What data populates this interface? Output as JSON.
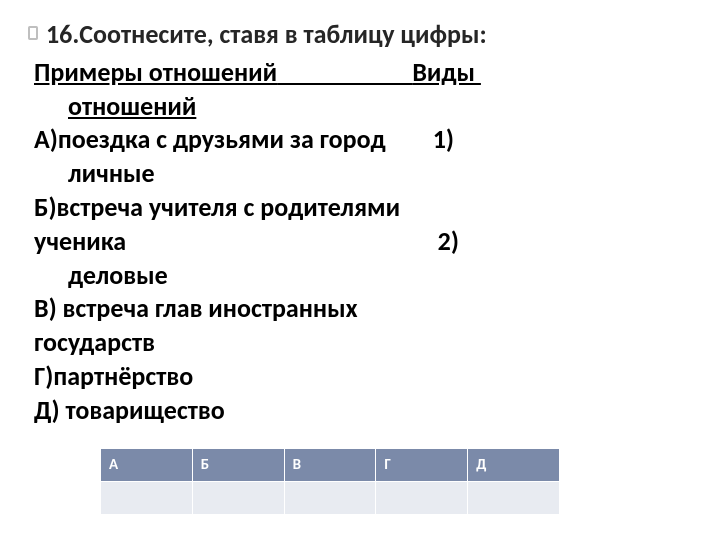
{
  "title": "16.Соотнесите, ставя в таблицу цифры:",
  "col_headers_line": {
    "left": "Примеры отношений",
    "spacer": "                       ",
    "right": "Виды "
  },
  "col_headers_cont": "отношений",
  "items": {
    "a_left": "А)поездка с друзьями за город",
    "a_spacer": "        ",
    "a_right": "1) ",
    "a_cont": "личные",
    "b_left": "Б)встреча учителя с родителями",
    "b_cont_left": "ученика",
    "b_cont_spacer": "                                                     ",
    "b_cont_right": "2) ",
    "b_cont2": "деловые",
    "v_left": "В) встреча глав иностранных",
    "v_cont": "государств",
    "g_left": "Г)партнёрство",
    "d_left": "Д) товарищество"
  },
  "table": {
    "headers": [
      "А",
      "Б",
      "В",
      "Г",
      "Д"
    ],
    "row": [
      "",
      "",
      "",
      "",
      ""
    ]
  },
  "chart_data": {
    "type": "table",
    "title": "Соотнесите примеры и виды отношений",
    "examples": [
      "А) поездка с друзьями за город",
      "Б) встреча учителя с родителями ученика",
      "В) встреча глав иностранных государств",
      "Г) партнёрство",
      "Д) товарищество"
    ],
    "relation_types": [
      "1) личные",
      "2) деловые"
    ],
    "answer_grid_columns": [
      "А",
      "Б",
      "В",
      "Г",
      "Д"
    ],
    "answer_grid_values": [
      "",
      "",
      "",
      "",
      ""
    ]
  }
}
